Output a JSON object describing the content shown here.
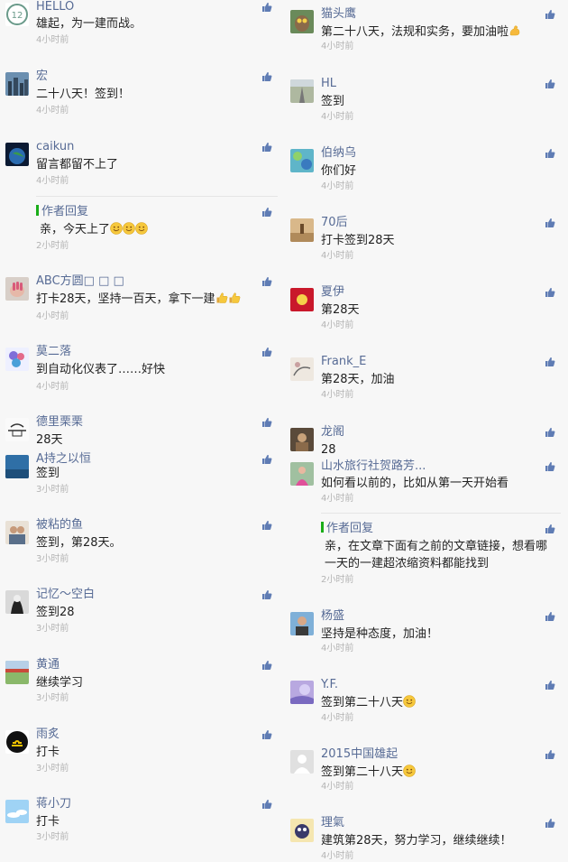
{
  "left": [
    {
      "name": "HELLO",
      "text": "雄起，为一建而战。",
      "time": "4小时前",
      "avatar": "av-hello",
      "nameTop": 0,
      "textTop": 18,
      "timeTop": 39
    },
    {
      "name": "宏",
      "text": "二十八天！签到！",
      "time": "4小时前",
      "avatar": "av-city",
      "nameTop": 77,
      "textTop": 96,
      "timeTop": 117
    },
    {
      "name": "caikun",
      "text": "留言都留不上了",
      "time": "4小时前",
      "avatar": "av-globe",
      "nameTop": 155,
      "textTop": 174,
      "timeTop": 195
    },
    {
      "name": "作者回复",
      "text": "亲，今天上了",
      "time": "2小时前",
      "avatar": "",
      "nameTop": 227,
      "textTop": 246,
      "timeTop": 267,
      "reply": true,
      "emoji": "smile3"
    },
    {
      "name": "ABC方圆□ □ □",
      "text": "打卡28天，坚持一百天，拿下一建",
      "time": "4小时前",
      "avatar": "av-hand",
      "nameTop": 304,
      "textTop": 323,
      "timeTop": 345,
      "emoji": "thumbs2"
    },
    {
      "name": "莫二落",
      "text": "到自动化仪表了……好快",
      "time": "4小时前",
      "avatar": "av-flower",
      "nameTop": 382,
      "textTop": 401,
      "timeTop": 423
    },
    {
      "name": "德里栗栗",
      "text": "28天",
      "time": "",
      "avatar": "av-bw",
      "nameTop": 460,
      "textTop": 479,
      "timeTop": 0
    },
    {
      "name": "A持之以恒",
      "text": "签到",
      "time": "3小时前",
      "avatar": "av-sea",
      "nameTop": 501,
      "textTop": 516,
      "timeTop": 537
    },
    {
      "name": "被粘的鱼",
      "text": "签到，第28天。",
      "time": "3小时前",
      "avatar": "av-people",
      "nameTop": 574,
      "textTop": 593,
      "timeTop": 614
    },
    {
      "name": "记忆～空白",
      "text": "签到28",
      "time": "3小时前",
      "avatar": "av-dark",
      "nameTop": 651,
      "textTop": 670,
      "timeTop": 691
    },
    {
      "name": "黄通",
      "text": "继续学习",
      "time": "3小时前",
      "avatar": "av-field",
      "nameTop": 729,
      "textTop": 748,
      "timeTop": 768
    },
    {
      "name": "雨炙",
      "text": "打卡",
      "time": "3小时前",
      "avatar": "av-libra",
      "nameTop": 806,
      "textTop": 825,
      "timeTop": 846
    },
    {
      "name": "蒋小刀",
      "text": "打卡",
      "time": "3小时前",
      "avatar": "av-sky",
      "nameTop": 883,
      "textTop": 902,
      "timeTop": 922
    }
  ],
  "right": [
    {
      "name": "猫头鹰",
      "text": "第二十八天，法规和实务，要加油啦",
      "time": "4小时前",
      "avatar": "av-owl",
      "nameTop": 8,
      "textTop": 27,
      "timeTop": 46,
      "emoji": "muscle"
    },
    {
      "name": "HL",
      "text": "签到",
      "time": "4小时前",
      "avatar": "av-road",
      "nameTop": 85,
      "textTop": 104,
      "timeTop": 124
    },
    {
      "name": "伯纳乌",
      "text": "你们好",
      "time": "4小时前",
      "avatar": "av-colorful",
      "nameTop": 162,
      "textTop": 181,
      "timeTop": 201
    },
    {
      "name": "70后",
      "text": "打卡签到28天",
      "time": "4小时前",
      "avatar": "av-desert",
      "nameTop": 239,
      "textTop": 258,
      "timeTop": 278
    },
    {
      "name": "夏伊",
      "text": "第28天",
      "time": "4小时前",
      "avatar": "av-red",
      "nameTop": 316,
      "textTop": 335,
      "timeTop": 355
    },
    {
      "name": "Frank_E",
      "text": "第28天，加油",
      "time": "4小时前",
      "avatar": "av-paint",
      "nameTop": 393,
      "textTop": 412,
      "timeTop": 432
    },
    {
      "name": "龙阁",
      "text": "28",
      "time": "",
      "avatar": "av-brown",
      "nameTop": 471,
      "textTop": 490,
      "timeTop": 0
    },
    {
      "name": "山水旅行社贺路芳...",
      "text": "如何看以前的，比如从第一天开始看",
      "time": "4小时前",
      "avatar": "av-pink",
      "nameTop": 509,
      "textTop": 527,
      "timeTop": 547
    },
    {
      "name": "作者回复",
      "text": "亲，在文章下面有之前的文章链接，想看哪",
      "text2": "一天的一建超浓缩资料都能找到",
      "time": "2小时前",
      "avatar": "",
      "nameTop": 578,
      "textTop": 597,
      "text2Top": 616,
      "timeTop": 637,
      "reply": true
    },
    {
      "name": "杨盛",
      "text": "坚持是种态度，加油！",
      "time": "4小时前",
      "avatar": "av-man",
      "nameTop": 675,
      "textTop": 694,
      "timeTop": 713
    },
    {
      "name": "Y.F.",
      "text": "签到第二十八天",
      "time": "4小时前",
      "avatar": "av-purple",
      "nameTop": 751,
      "textTop": 770,
      "timeTop": 790,
      "emoji": "smile1"
    },
    {
      "name": "2015中国雄起",
      "text": "签到第二十八天",
      "time": "4小时前",
      "avatar": "av-default",
      "nameTop": 828,
      "textTop": 847,
      "timeTop": 866,
      "emoji": "smile1"
    },
    {
      "name": "理氣",
      "text": "建筑第28天，努力学习，继续继续！",
      "time": "4小时前",
      "avatar": "av-cartoon",
      "nameTop": 904,
      "textTop": 923,
      "timeTop": 943
    }
  ],
  "colors": {
    "name": "#576b95",
    "text": "#222222",
    "time": "#b4b4b4",
    "reply_mark": "#1aad19",
    "background": "#f7f7f7"
  }
}
